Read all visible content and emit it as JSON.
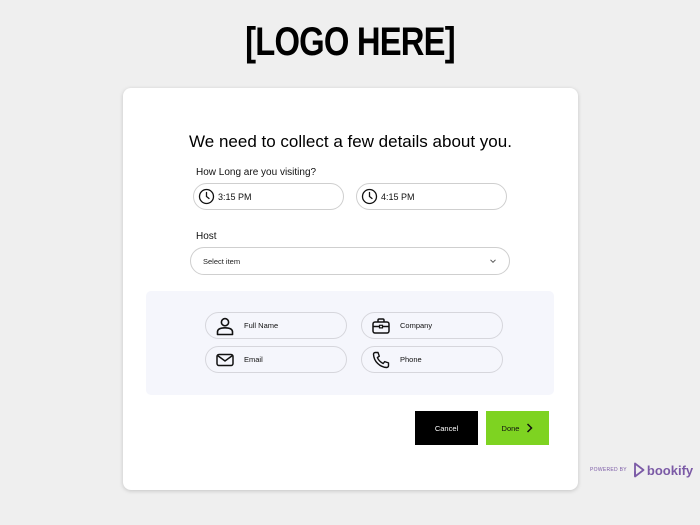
{
  "logo": {
    "text": "[LOGO HERE]"
  },
  "form": {
    "headline": "We need to collect a few details about you.",
    "visit_label": "How Long are you visiting?",
    "start_time": "3:15 PM",
    "end_time": "4:15 PM",
    "host_label": "Host",
    "host_placeholder": "Select item",
    "fields": {
      "full_name": "Full Name",
      "company": "Company",
      "email": "Email",
      "phone": "Phone"
    },
    "cancel_label": "Cancel",
    "done_label": "Done"
  },
  "footer": {
    "powered_by": "POWERED BY",
    "brand": "bookify"
  },
  "colors": {
    "background": "#efefef",
    "panel": "#f5f6fc",
    "done_button": "#7ed321",
    "cancel_button": "#000000",
    "brand": "#7b5aa6"
  },
  "icons": [
    "clock-icon",
    "chevron-down-icon",
    "person-icon",
    "briefcase-icon",
    "envelope-icon",
    "phone-icon",
    "chevron-right-icon",
    "bookify-logo-icon"
  ]
}
